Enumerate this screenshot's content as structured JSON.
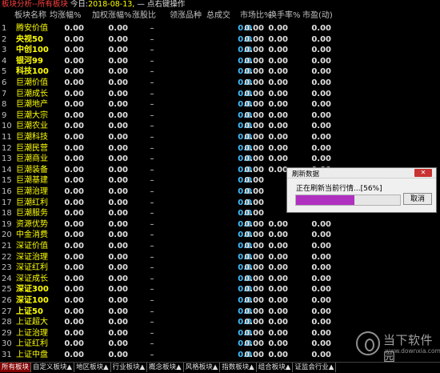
{
  "title_bar": {
    "part1": "板块分析--所有板块",
    "part2": "今日:",
    "date": "2018-08-13,",
    "hint": "—  点右键操作"
  },
  "columns": [
    "板块名称",
    "均涨幅%",
    "加权涨幅%",
    "涨股比",
    "领涨品种",
    "总成交",
    "市场比%",
    "换手率%",
    "市盈(动)"
  ],
  "rows": [
    {
      "num": "1",
      "name": "腾安价值",
      "avg": "0.00",
      "wavg": "0.00",
      "ratio": "–",
      "leader": "",
      "amount": "0.0",
      "market": "0.00",
      "turnover": "0.00",
      "pe": "0.00"
    },
    {
      "num": "2",
      "name": "央视50",
      "avg": "0.00",
      "wavg": "0.00",
      "ratio": "–",
      "leader": "",
      "amount": "0.0",
      "market": "0.00",
      "turnover": "0.00",
      "pe": "0.00"
    },
    {
      "num": "3",
      "name": "中创100",
      "avg": "0.00",
      "wavg": "0.00",
      "ratio": "–",
      "leader": "",
      "amount": "0.0",
      "market": "0.00",
      "turnover": "0.00",
      "pe": "0.00"
    },
    {
      "num": "4",
      "name": "银河99",
      "avg": "0.00",
      "wavg": "0.00",
      "ratio": "–",
      "leader": "",
      "amount": "0.0",
      "market": "0.00",
      "turnover": "0.00",
      "pe": "0.00"
    },
    {
      "num": "5",
      "name": "科技100",
      "avg": "0.00",
      "wavg": "0.00",
      "ratio": "–",
      "leader": "",
      "amount": "0.0",
      "market": "0.00",
      "turnover": "0.00",
      "pe": "0.00"
    },
    {
      "num": "6",
      "name": "巨潮价值",
      "avg": "0.00",
      "wavg": "0.00",
      "ratio": "–",
      "leader": "",
      "amount": "0.0",
      "market": "0.00",
      "turnover": "0.00",
      "pe": "0.00"
    },
    {
      "num": "7",
      "name": "巨潮成长",
      "avg": "0.00",
      "wavg": "0.00",
      "ratio": "–",
      "leader": "",
      "amount": "0.0",
      "market": "0.00",
      "turnover": "0.00",
      "pe": "0.00"
    },
    {
      "num": "8",
      "name": "巨潮地产",
      "avg": "0.00",
      "wavg": "0.00",
      "ratio": "–",
      "leader": "",
      "amount": "0.0",
      "market": "0.00",
      "turnover": "0.00",
      "pe": "0.00"
    },
    {
      "num": "9",
      "name": "巨潮大宗",
      "avg": "0.00",
      "wavg": "0.00",
      "ratio": "–",
      "leader": "",
      "amount": "0.0",
      "market": "0.00",
      "turnover": "0.00",
      "pe": "0.00"
    },
    {
      "num": "10",
      "name": "巨潮农业",
      "avg": "0.00",
      "wavg": "0.00",
      "ratio": "–",
      "leader": "",
      "amount": "0.0",
      "market": "0.00",
      "turnover": "0.00",
      "pe": "0.00"
    },
    {
      "num": "11",
      "name": "巨潮科技",
      "avg": "0.00",
      "wavg": "0.00",
      "ratio": "–",
      "leader": "",
      "amount": "0.0",
      "market": "0.00",
      "turnover": "0.00",
      "pe": "0.00"
    },
    {
      "num": "12",
      "name": "巨潮民营",
      "avg": "0.00",
      "wavg": "0.00",
      "ratio": "–",
      "leader": "",
      "amount": "0.0",
      "market": "0.00",
      "turnover": "0.00",
      "pe": "0.00"
    },
    {
      "num": "13",
      "name": "巨潮商业",
      "avg": "0.00",
      "wavg": "0.00",
      "ratio": "–",
      "leader": "",
      "amount": "0.0",
      "market": "0.00",
      "turnover": "0.00",
      "pe": "0.00"
    },
    {
      "num": "14",
      "name": "巨潮装备",
      "avg": "0.00",
      "wavg": "0.00",
      "ratio": "–",
      "leader": "",
      "amount": "0.0",
      "market": "0.00",
      "turnover": "0.00",
      "pe": "0.00"
    },
    {
      "num": "15",
      "name": "巨潮基建",
      "avg": "0.00",
      "wavg": "0.00",
      "ratio": "–",
      "leader": "",
      "amount": "0.0",
      "market": "0.00",
      "turnover": "",
      "pe": ""
    },
    {
      "num": "16",
      "name": "巨潮治理",
      "avg": "0.00",
      "wavg": "0.00",
      "ratio": "–",
      "leader": "",
      "amount": "0.0",
      "market": "0.00",
      "turnover": "",
      "pe": ""
    },
    {
      "num": "17",
      "name": "巨潮红利",
      "avg": "0.00",
      "wavg": "0.00",
      "ratio": "–",
      "leader": "",
      "amount": "0.0",
      "market": "0.00",
      "turnover": "",
      "pe": ""
    },
    {
      "num": "18",
      "name": "巨潮服务",
      "avg": "0.00",
      "wavg": "0.00",
      "ratio": "–",
      "leader": "",
      "amount": "0.0",
      "market": "0.00",
      "turnover": "",
      "pe": ""
    },
    {
      "num": "19",
      "name": "资源优势",
      "avg": "0.00",
      "wavg": "0.00",
      "ratio": "–",
      "leader": "",
      "amount": "0.0",
      "market": "0.00",
      "turnover": "0.00",
      "pe": "0.00"
    },
    {
      "num": "20",
      "name": "中金消费",
      "avg": "0.00",
      "wavg": "0.00",
      "ratio": "–",
      "leader": "",
      "amount": "0.0",
      "market": "0.00",
      "turnover": "0.00",
      "pe": "0.00"
    },
    {
      "num": "21",
      "name": "深证价值",
      "avg": "0.00",
      "wavg": "0.00",
      "ratio": "–",
      "leader": "",
      "amount": "0.0",
      "market": "0.00",
      "turnover": "0.00",
      "pe": "0.00"
    },
    {
      "num": "22",
      "name": "深证治理",
      "avg": "0.00",
      "wavg": "0.00",
      "ratio": "–",
      "leader": "",
      "amount": "0.0",
      "market": "0.00",
      "turnover": "0.00",
      "pe": "0.00"
    },
    {
      "num": "23",
      "name": "深证红利",
      "avg": "0.00",
      "wavg": "0.00",
      "ratio": "–",
      "leader": "",
      "amount": "0.0",
      "market": "0.00",
      "turnover": "0.00",
      "pe": "0.00"
    },
    {
      "num": "24",
      "name": "深证成长",
      "avg": "0.00",
      "wavg": "0.00",
      "ratio": "–",
      "leader": "",
      "amount": "0.0",
      "market": "0.00",
      "turnover": "0.00",
      "pe": "0.00"
    },
    {
      "num": "25",
      "name": "深证300",
      "avg": "0.00",
      "wavg": "0.00",
      "ratio": "–",
      "leader": "",
      "amount": "0.0",
      "market": "0.00",
      "turnover": "0.00",
      "pe": "0.00"
    },
    {
      "num": "26",
      "name": "深证100",
      "avg": "0.00",
      "wavg": "0.00",
      "ratio": "–",
      "leader": "",
      "amount": "0.0",
      "market": "0.00",
      "turnover": "0.00",
      "pe": "0.00"
    },
    {
      "num": "27",
      "name": "上证50",
      "avg": "0.00",
      "wavg": "0.00",
      "ratio": "–",
      "leader": "",
      "amount": "0.0",
      "market": "0.00",
      "turnover": "0.00",
      "pe": "0.00"
    },
    {
      "num": "28",
      "name": "上证超大",
      "avg": "0.00",
      "wavg": "0.00",
      "ratio": "–",
      "leader": "",
      "amount": "0.0",
      "market": "0.00",
      "turnover": "0.00",
      "pe": "0.00"
    },
    {
      "num": "29",
      "name": "上证治理",
      "avg": "0.00",
      "wavg": "0.00",
      "ratio": "–",
      "leader": "",
      "amount": "0.0",
      "market": "0.00",
      "turnover": "0.00",
      "pe": "0.00"
    },
    {
      "num": "30",
      "name": "上证红利",
      "avg": "0.00",
      "wavg": "0.00",
      "ratio": "–",
      "leader": "",
      "amount": "0.0",
      "market": "0.00",
      "turnover": "0.00",
      "pe": "0.00"
    },
    {
      "num": "31",
      "name": "上证中盘",
      "avg": "0.00",
      "wavg": "0.00",
      "ratio": "–",
      "leader": "",
      "amount": "0.0",
      "market": "0.00",
      "turnover": "0.00",
      "pe": "0.00"
    }
  ],
  "tabs": [
    "所有板块",
    "自定义板块▲",
    "地区板块▲",
    "行业板块▲",
    "概念板块▲",
    "风格板块▲",
    "指数板块▲",
    "组合板块▲",
    "证监会行业▲"
  ],
  "dialog": {
    "title": "刷新数据",
    "close": "✕",
    "message": "正在刷新当前行情...[56%]",
    "progress": 0.56,
    "cancel": "取消"
  },
  "watermark": {
    "cn": "当下软件园",
    "en": "www.downxia.com"
  }
}
